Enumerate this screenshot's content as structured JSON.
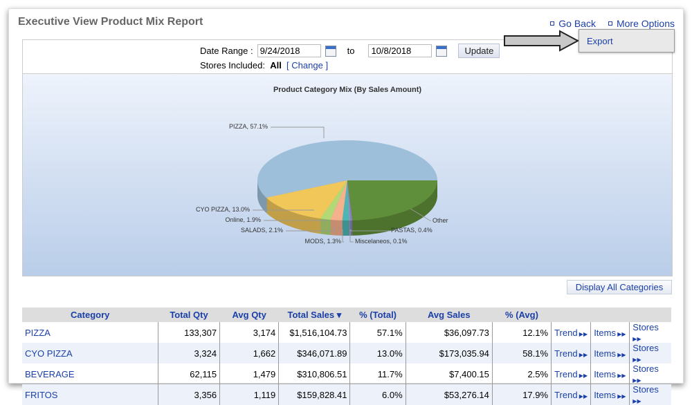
{
  "header": {
    "title": "Executive View Product Mix Report",
    "go_back": "Go Back",
    "more_options": "More Options"
  },
  "menu": {
    "export": "Export"
  },
  "filter": {
    "date_range_label": "Date Range :",
    "start_date": "9/24/2018",
    "to_label": "to",
    "end_date": "10/8/2018",
    "update": "Update",
    "stores_label": "Stores Included:",
    "stores_value": "All",
    "change_open": "[",
    "change": "Change",
    "change_close": "]"
  },
  "display_all": "Display All Categories",
  "chart_data": {
    "type": "pie",
    "title": "Product Category Mix (By Sales Amount)",
    "slices": [
      {
        "label": "PIZZA, 57.1%",
        "value": 57.1,
        "color": "#9dbfd9"
      },
      {
        "label": "CYO PIZZA, 13.0%",
        "value": 13.0,
        "color": "#f2c75a"
      },
      {
        "label": "Online, 1.9%",
        "value": 1.9,
        "color": "#b4d876"
      },
      {
        "label": "SALADS, 2.1%",
        "value": 2.1,
        "color": "#f5b08c"
      },
      {
        "label": "MODS, 1.3%",
        "value": 1.3,
        "color": "#4fb5b4"
      },
      {
        "label": "Miscelaneos, 0.1%",
        "value": 0.1,
        "color": "#c98fc6"
      },
      {
        "label": "PASTAS, 0.4%",
        "value": 0.4,
        "color": "#8a7fc0"
      },
      {
        "label": "Other",
        "value": 24.1,
        "color": "#5f8f3a"
      }
    ]
  },
  "table": {
    "headers": [
      "Category",
      "Total Qty",
      "Avg Qty",
      "Total Sales ▾",
      "% (Total)",
      "Avg Sales",
      "% (Avg)"
    ],
    "link_labels": [
      "Trend",
      "Items",
      "Stores"
    ],
    "rows": [
      [
        "PIZZA",
        "133,307",
        "3,174",
        "$1,516,104.73",
        "57.1%",
        "$36,097.73",
        "12.1%"
      ],
      [
        "CYO PIZZA",
        "3,324",
        "1,662",
        "$346,071.89",
        "13.0%",
        "$173,035.94",
        "58.1%"
      ],
      [
        "BEVERAGE",
        "62,115",
        "1,479",
        "$310,806.51",
        "11.7%",
        "$7,400.15",
        "2.5%"
      ],
      [
        "FRITOS",
        "3,356",
        "1,119",
        "$159,828.41",
        "6.0%",
        "$53,276.14",
        "17.9%"
      ]
    ]
  }
}
